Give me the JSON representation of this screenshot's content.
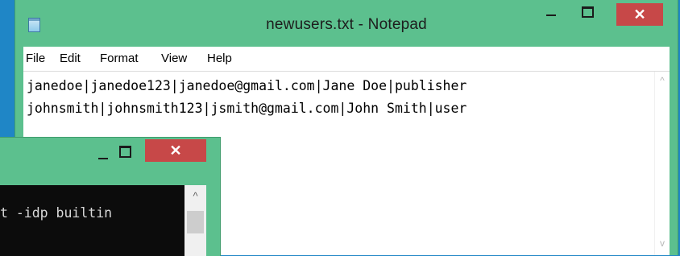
{
  "notepad": {
    "title": "newusers.txt - Notepad",
    "icon": "notepad-icon",
    "close_glyph": "✕",
    "menus": [
      "File",
      "Edit",
      "Format",
      "View",
      "Help"
    ],
    "lines": [
      "janedoe|janedoe123|janedoe@gmail.com|Jane Doe|publisher",
      "johnsmith|johnsmith123|jsmith@gmail.com|John Smith|user"
    ],
    "scroll_up": "^",
    "scroll_down": "v"
  },
  "console": {
    "close_glyph": "✕",
    "visible_text": "t -idp builtin",
    "scroll_up": "^"
  },
  "colors": {
    "desktop": "#1f86c6",
    "window_frame": "#5cc08e",
    "close_button": "#c74848"
  }
}
